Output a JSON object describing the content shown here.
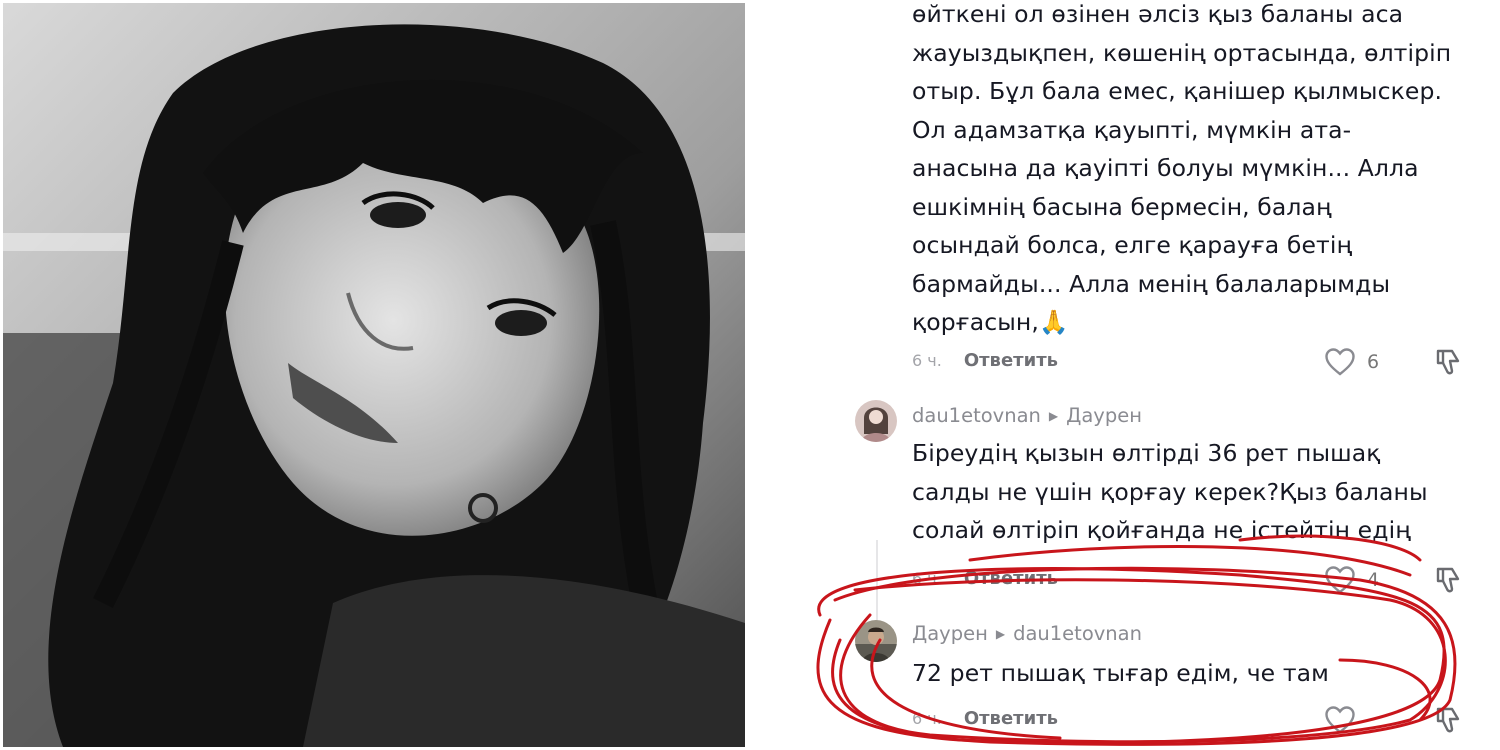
{
  "photo": {
    "description_icon": "portrait-photo-icon"
  },
  "comments": {
    "main": {
      "lines": [
        "өйткені ол өзінен әлсіз қыз баланы аса",
        "жауыздықпен, көшенің ортасында, өлтіріп",
        "отыр. Бұл бала емес, қанішер қылмыскер.",
        "Ол адамзатқа қауыпті, мүмкін ата-",
        "анасына да қауіпті болуы мүмкін... Алла",
        "ешкімнің басына бермесін, балаң",
        "осындай болса, елге қарауға бетің",
        "бармайды... Алла менің балаларымды",
        "қорғасын,🙏"
      ],
      "time": "6 ч.",
      "reply_label": "Ответить",
      "likes": "6"
    },
    "reply1": {
      "author": "dau1etovnan",
      "to": "Даурен",
      "lines": [
        "Біреудің қызын өлтірді 36 рет пышақ",
        "салды не үшін қорғау керек?Қыз баланы",
        "солай өлтіріп қойғанда не істейтін едің"
      ],
      "time": "6 ч.",
      "reply_label": "Ответить",
      "likes": "4"
    },
    "reply2": {
      "author": "Даурен",
      "to": "dau1etovnan",
      "lines": [
        "72 рет пышақ тығар едім, че там"
      ],
      "time": "6 ч.",
      "reply_label": "Ответить",
      "likes": ""
    }
  },
  "colors": {
    "scribble": "#c8151b",
    "text": "#161823",
    "meta": "#8a8b91"
  }
}
